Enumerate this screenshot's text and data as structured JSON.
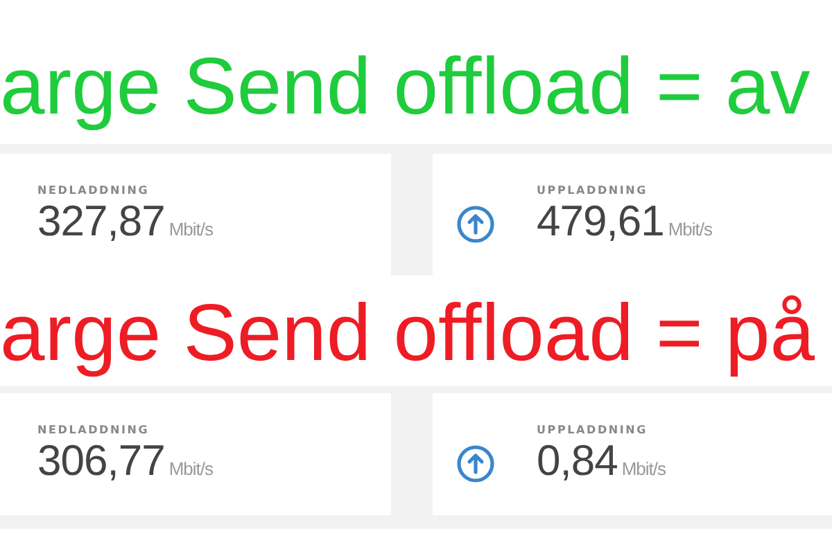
{
  "sections": [
    {
      "heading": "arge Send offload = av",
      "color": "#1fcc3c",
      "cards": [
        {
          "kind": "download",
          "label": "NEDLADDNING",
          "value": "327,87",
          "unit": "Mbit/s"
        },
        {
          "kind": "upload",
          "label": "UPPLADDNING",
          "value": "479,61",
          "unit": "Mbit/s"
        }
      ]
    },
    {
      "heading": "arge Send offload = på",
      "color": "#ee1c25",
      "cards": [
        {
          "kind": "download",
          "label": "NEDLADDNING",
          "value": "306,77",
          "unit": "Mbit/s"
        },
        {
          "kind": "upload",
          "label": "UPPLADDNING",
          "value": "0,84",
          "unit": "Mbit/s"
        }
      ]
    }
  ]
}
